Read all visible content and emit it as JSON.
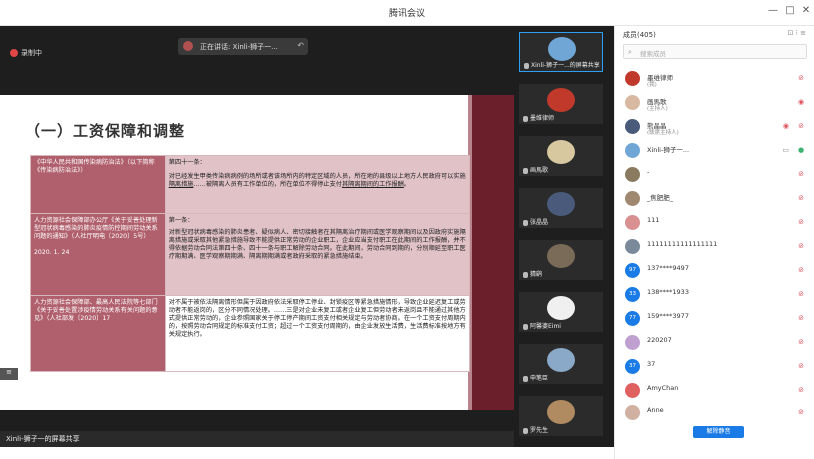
{
  "window": {
    "title": "腾讯会议",
    "controls": [
      "—",
      "□",
      "✕"
    ]
  },
  "share": {
    "recording_label": "录制中",
    "speaking_label": "正在讲话: Xinli-狮子一...",
    "bottom_label": "Xinli-狮子一的屏幕共享",
    "low_bar_label": "≡"
  },
  "slide": {
    "title": "（一）工资保障和调整",
    "rows": [
      {
        "left": "《中华人民共和国传染病防治法》（以下简称《传染病防治法》）",
        "right_head": "第四十一条：",
        "right_body_1": "对已经发生甲类传染病病例的场所或者该场所内的特定区域的人员，所在地的县级以上地方人民政府可以实施",
        "right_u1": "隔离措施",
        "right_body_2": "……被隔离人员有工作单位的，所在单位不得停止支付",
        "right_u2": "其隔离期间的工作报酬",
        "right_body_3": "。"
      },
      {
        "left": "人力资源社会保障部办公厅《关于妥善处理新型冠状病毒感染的肺炎疫情防控期间劳动关系问题的通知》（人社厅明电〔2020〕5号）",
        "left_date": "2020. 1. 24",
        "right_head": "第一条：",
        "right_body": "对新型冠状病毒感染的肺炎患者、疑似病人、密切接触者在其隔离治疗期间或医学观察期间以及因政府实施隔离措施或采取其他紧急措施导致不能提供正常劳动的企业职工，企业应当支付职工在此期间的工作报酬，并不得依据劳动合同法第四十条、四十一条与职工解除劳动合同。在此期间，劳动合同到期的，分别顺延至职工医疗期期满、医学观察期期满、隔离期期满或者政府采取的紧急措施结束。"
      },
      {
        "left": "人力资源社会保障部、最高人民法院等七部门《关于妥善处置涉疫情劳动关系有关问题的意见》（人社部发〔2020〕17",
        "right_body": "对不属于被依法隔离情形但属于因政府依法采取停工停业、封锁疫区等紧急措施情形，导致企业延迟复工或劳动者不能返岗的，区分不同情况处理。……三是对企业未复工或者企业复工但劳动者未返岗且不能通过其他方式提供正常劳动的，企业参照国家关于停工停产期间工资支付相关规定与劳动者协商。在一个工资支付周期内的，按照劳动合同规定的标准支付工资；超过一个工资支付周期的，由企业发放生活费，生活费标准按地方有关规定执行。"
      }
    ]
  },
  "thumbs": [
    {
      "name": "Xinli-狮子一...的屏幕共享",
      "color": "#6fa6d6"
    },
    {
      "name": "墨维律师",
      "color": "#c0392b"
    },
    {
      "name": "画馬歌",
      "color": "#d8c8a0"
    },
    {
      "name": "张晶晶",
      "color": "#4a5a7a"
    },
    {
      "name": "猜鹞",
      "color": "#7a6a58"
    },
    {
      "name": "阿馨婆Eimi",
      "color": "#f0f0f0"
    },
    {
      "name": "申笔臣",
      "color": "#8aa8c8"
    },
    {
      "name": "罗先生",
      "color": "#b08a60"
    }
  ],
  "panel": {
    "header": "成员(405)",
    "header_icons": "⊡ ⁝ ≡",
    "search_placeholder": "搜索成员",
    "mute_all": "解除静音",
    "members": [
      {
        "name": "墨维律师",
        "sub": "(我)",
        "avatar": "#c0392b",
        "initials": ""
      },
      {
        "name": "画馬歌",
        "sub": "(主持人)",
        "avatar": "#d8b8a0",
        "initials": ""
      },
      {
        "name": "熊晶晶",
        "sub": "(联席主持人)",
        "avatar": "#4a5a7a",
        "initials": ""
      },
      {
        "name": "Xinli-狮子一...",
        "sub": "",
        "avatar": "#6fa6d6",
        "initials": ""
      },
      {
        "name": "-",
        "sub": "",
        "avatar": "#8a7a60",
        "initials": ""
      },
      {
        "name": "_焦肥肥_",
        "sub": "",
        "avatar": "#a08870",
        "initials": ""
      },
      {
        "name": "111",
        "sub": "",
        "avatar": "#d89090",
        "initials": ""
      },
      {
        "name": "11111111111111111",
        "sub": "",
        "avatar": "#7a8a9a",
        "initials": ""
      },
      {
        "name": "137****9497",
        "sub": "",
        "avatar": "#1a7be6",
        "initials": "97"
      },
      {
        "name": "138****1933",
        "sub": "",
        "avatar": "#1a7be6",
        "initials": "33"
      },
      {
        "name": "159****3977",
        "sub": "",
        "avatar": "#1a7be6",
        "initials": "77"
      },
      {
        "name": "220207",
        "sub": "",
        "avatar": "#c0a0d0",
        "initials": ""
      },
      {
        "name": "37",
        "sub": "",
        "avatar": "#1a7be6",
        "initials": "37"
      },
      {
        "name": "AmyChan",
        "sub": "",
        "avatar": "#e06060",
        "initials": ""
      },
      {
        "name": "Anne",
        "sub": "",
        "avatar": "#d0b0a0",
        "initials": ""
      }
    ]
  }
}
